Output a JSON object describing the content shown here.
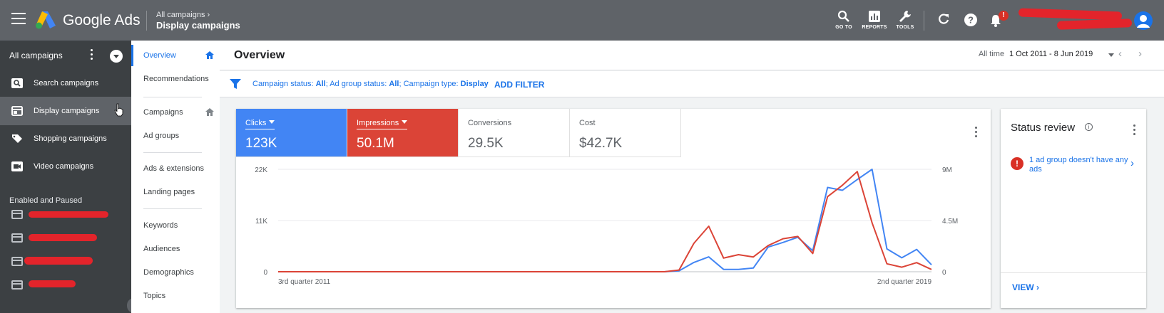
{
  "app": {
    "product_name": "Google Ads",
    "breadcrumb_parent": "All campaigns",
    "breadcrumb_current": "Display campaigns",
    "breadcrumb_chevron": "›"
  },
  "toolbar": {
    "goto_label": "GO TO",
    "reports_label": "REPORTS",
    "tools_label": "TOOLS",
    "notification_count": "!"
  },
  "leftnav": {
    "header": "All campaigns",
    "items": [
      {
        "label": "Search campaigns",
        "icon": "search-campaign-icon"
      },
      {
        "label": "Display campaigns",
        "icon": "display-campaign-icon"
      },
      {
        "label": "Shopping campaigns",
        "icon": "shopping-tag-icon"
      },
      {
        "label": "Video campaigns",
        "icon": "video-camera-icon"
      }
    ],
    "group_label": "Enabled and Paused",
    "collapse_glyph": "‹"
  },
  "pagemenu": {
    "items": [
      "Overview",
      "Recommendations",
      "Campaigns",
      "Ad groups",
      "Ads & extensions",
      "Landing pages",
      "Keywords",
      "Audiences",
      "Demographics",
      "Topics"
    ]
  },
  "header": {
    "title": "Overview",
    "all_time_label": "All time",
    "date_range": "1 Oct 2011 - 8 Jun 2019",
    "prev_glyph": "‹",
    "next_glyph": "›"
  },
  "filter": {
    "part1": "Campaign status: ",
    "v1": "All",
    "part2": "; Ad group status: ",
    "v2": "All",
    "part3": "; Campaign type: ",
    "v3": "Display",
    "add_filter": "ADD FILTER"
  },
  "metrics": [
    {
      "name": "Clicks",
      "value": "123K",
      "color": "#4285f4"
    },
    {
      "name": "Impressions",
      "value": "50.1M",
      "color": "#db4437"
    },
    {
      "name": "Conversions",
      "value": "29.5K"
    },
    {
      "name": "Cost",
      "value": "$42.7K"
    }
  ],
  "chart_data": {
    "type": "line",
    "xlabel_start": "3rd quarter 2011",
    "xlabel_end": "2nd quarter 2019",
    "left_axis": {
      "ticks": [
        "22K",
        "11K",
        "0"
      ],
      "ylim": [
        0,
        22000
      ]
    },
    "right_axis": {
      "ticks": [
        "9M",
        "4.5M",
        "0"
      ],
      "ylim": [
        0,
        9000000
      ]
    },
    "series": [
      {
        "name": "Clicks",
        "color": "#4285f4",
        "axis": "left",
        "values": [
          0,
          0,
          0,
          0,
          0,
          0,
          0,
          0,
          0,
          0,
          0,
          0,
          0,
          0,
          0,
          0,
          0,
          0,
          0,
          0,
          0,
          0,
          0,
          0,
          0,
          0,
          0,
          200,
          2000,
          3200,
          500,
          500,
          800,
          5300,
          6300,
          7400,
          4500,
          18100,
          17500,
          19800,
          22000,
          4900,
          3000,
          4800,
          1500
        ]
      },
      {
        "name": "Impressions",
        "color": "#db4437",
        "axis": "right",
        "values": [
          0,
          0,
          0,
          0,
          0,
          0,
          0,
          0,
          0,
          0,
          0,
          0,
          0,
          0,
          0,
          0,
          0,
          0,
          0,
          0,
          0,
          0,
          0,
          0,
          0,
          0,
          0,
          150000,
          2500000,
          4000000,
          1200000,
          1500000,
          1300000,
          2300000,
          2900000,
          3100000,
          1600000,
          6600000,
          7600000,
          8800000,
          4300000,
          700000,
          400000,
          800000,
          200000
        ]
      }
    ]
  },
  "status_review": {
    "title": "Status review",
    "info_glyph": "i",
    "alert_glyph": "!",
    "message": "1 ad group doesn't have any ads",
    "view_label": "VIEW",
    "chevron": "›"
  }
}
